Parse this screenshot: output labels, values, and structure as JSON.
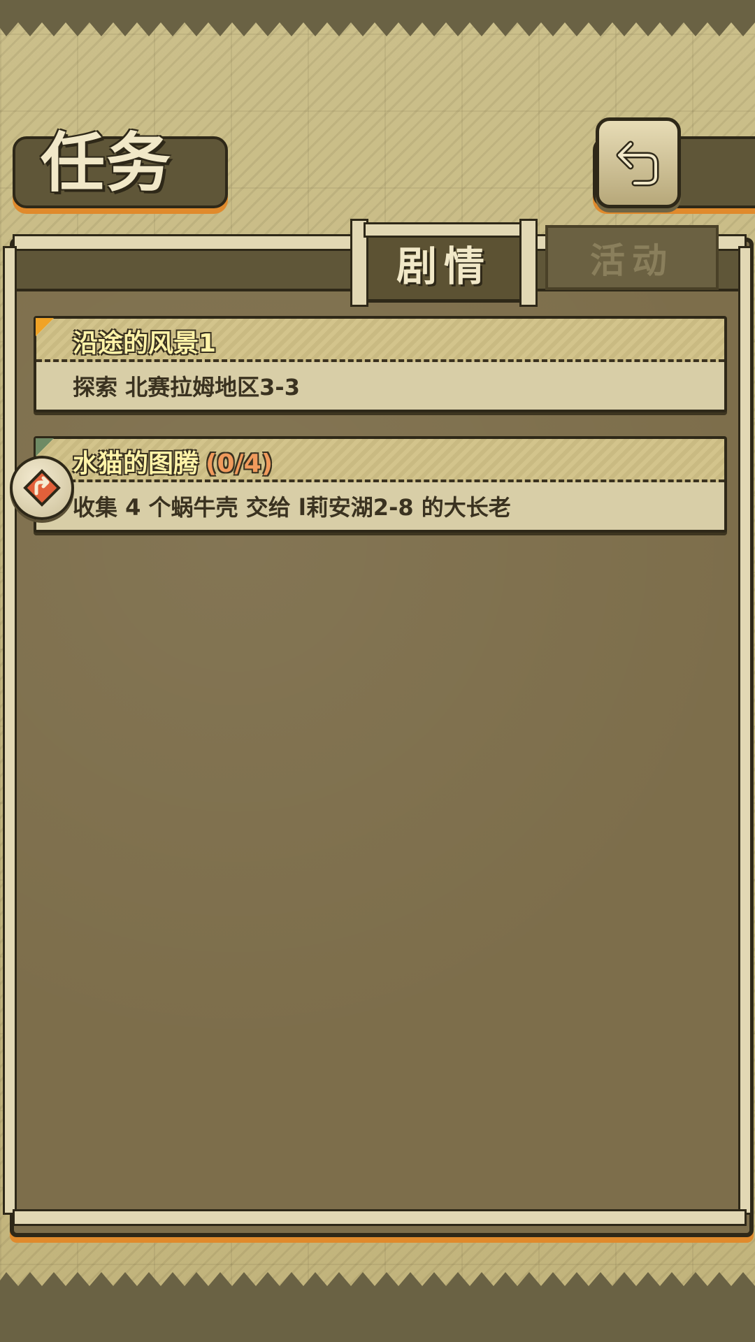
{
  "header": {
    "title": "任务"
  },
  "back_button": {
    "icon": "return-arrow-icon"
  },
  "tabs": [
    {
      "label": "剧情",
      "active": true
    },
    {
      "label": "活动",
      "active": false
    }
  ],
  "quests": [
    {
      "title": "沿途的风景1",
      "progress": "",
      "description": "探索 北赛拉姆地区3-3",
      "marker_color": "#f0a326"
    },
    {
      "title": "水猫的图腾",
      "progress": "(0/4)",
      "description": "收集 4 个蜗牛壳 交给 l莉安湖2-8 的大长老",
      "marker_color": "#6e8a64",
      "tracked": true
    }
  ],
  "colors": {
    "accent_orange": "#e08a2c",
    "title_yellow": "#fff3a8",
    "progress_orange": "#f09a5c"
  }
}
